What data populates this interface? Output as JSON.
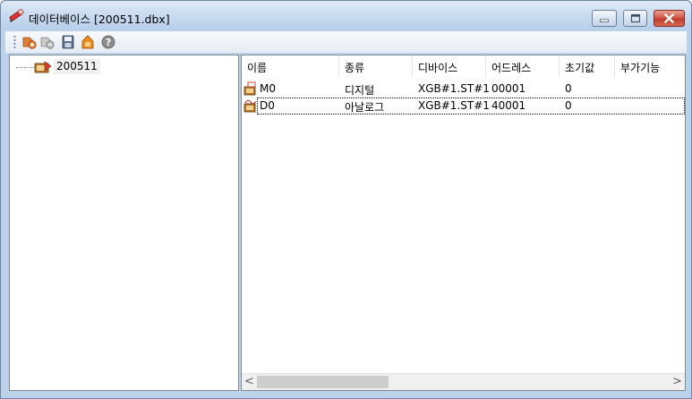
{
  "window": {
    "title": "데이터베이스 [200511.dbx]",
    "accent": "#bcd1ea",
    "title_icon": "database-pencil-icon"
  },
  "window_controls": {
    "minimize_icon": "minimize-icon",
    "maximize_icon": "maximize-icon",
    "close_icon": "close-icon"
  },
  "toolbar": {
    "buttons": [
      {
        "icon": "add-variable-icon"
      },
      {
        "icon": "remove-variable-icon"
      },
      {
        "icon": "save-icon"
      },
      {
        "icon": "export-icon"
      },
      {
        "icon": "help-icon"
      }
    ]
  },
  "tree": {
    "items": [
      {
        "label": "200511",
        "icon": "database-file-icon"
      }
    ]
  },
  "list": {
    "columns": [
      "이름",
      "종류",
      "디바이스",
      "어드레스",
      "초기값",
      "부가기능"
    ],
    "rows": [
      {
        "name": "M0",
        "type": "디지털",
        "device": "XGB#1.ST#1",
        "address": "00001",
        "initial": "0",
        "extra": "",
        "icon": "digital-tag-icon"
      },
      {
        "name": "D0",
        "type": "아날로그",
        "device": "XGB#1.ST#1",
        "address": "40001",
        "initial": "0",
        "extra": "",
        "icon": "analog-tag-icon"
      }
    ]
  },
  "scrollbar": {
    "left_arrow": "<",
    "right_arrow": ">"
  }
}
